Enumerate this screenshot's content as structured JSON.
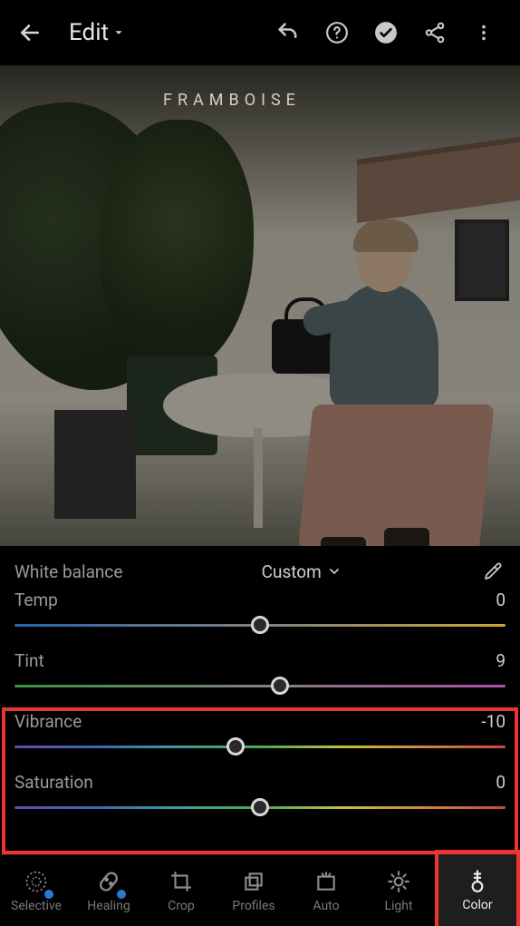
{
  "header": {
    "title": "Edit"
  },
  "photo": {
    "sign_text": "FRAMBOISE"
  },
  "adjust": {
    "white_balance_label": "White balance",
    "white_balance_value": "Custom",
    "sliders": {
      "temp": {
        "label": "Temp",
        "value": "0",
        "pos": 50
      },
      "tint": {
        "label": "Tint",
        "value": "9",
        "pos": 54
      },
      "vibrance": {
        "label": "Vibrance",
        "value": "-10",
        "pos": 45
      },
      "saturation": {
        "label": "Saturation",
        "value": "0",
        "pos": 50
      }
    }
  },
  "tabs": {
    "selective": "Selective",
    "healing": "Healing",
    "crop": "Crop",
    "profiles": "Profiles",
    "auto": "Auto",
    "light": "Light",
    "color": "Color"
  }
}
